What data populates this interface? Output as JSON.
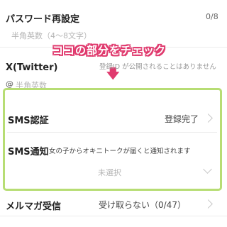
{
  "password_reset": {
    "label": "パスワード再設定",
    "counter": "0/8",
    "placeholder": "半角英数（4〜8文字）"
  },
  "annotation": {
    "text": "ココの部分をチェック",
    "arrow": "🡇"
  },
  "twitter": {
    "label": "X(Twitter)",
    "note": "登録ID が公開されることはありません",
    "at_symbol": "@",
    "placeholder": "半角英数"
  },
  "sms_auth": {
    "label": "SMS認証",
    "status": "登録完了"
  },
  "sms_notify": {
    "label": "SMS通知",
    "description": "女の子からオキニトークが届くと通知されます",
    "select_placeholder": "未選択"
  },
  "mail_magazine": {
    "label": "メルマガ受信",
    "value": "受け取らない（0/47）"
  },
  "colors": {
    "highlight_border": "#b7dd74",
    "annotation": "#e03a6e"
  }
}
